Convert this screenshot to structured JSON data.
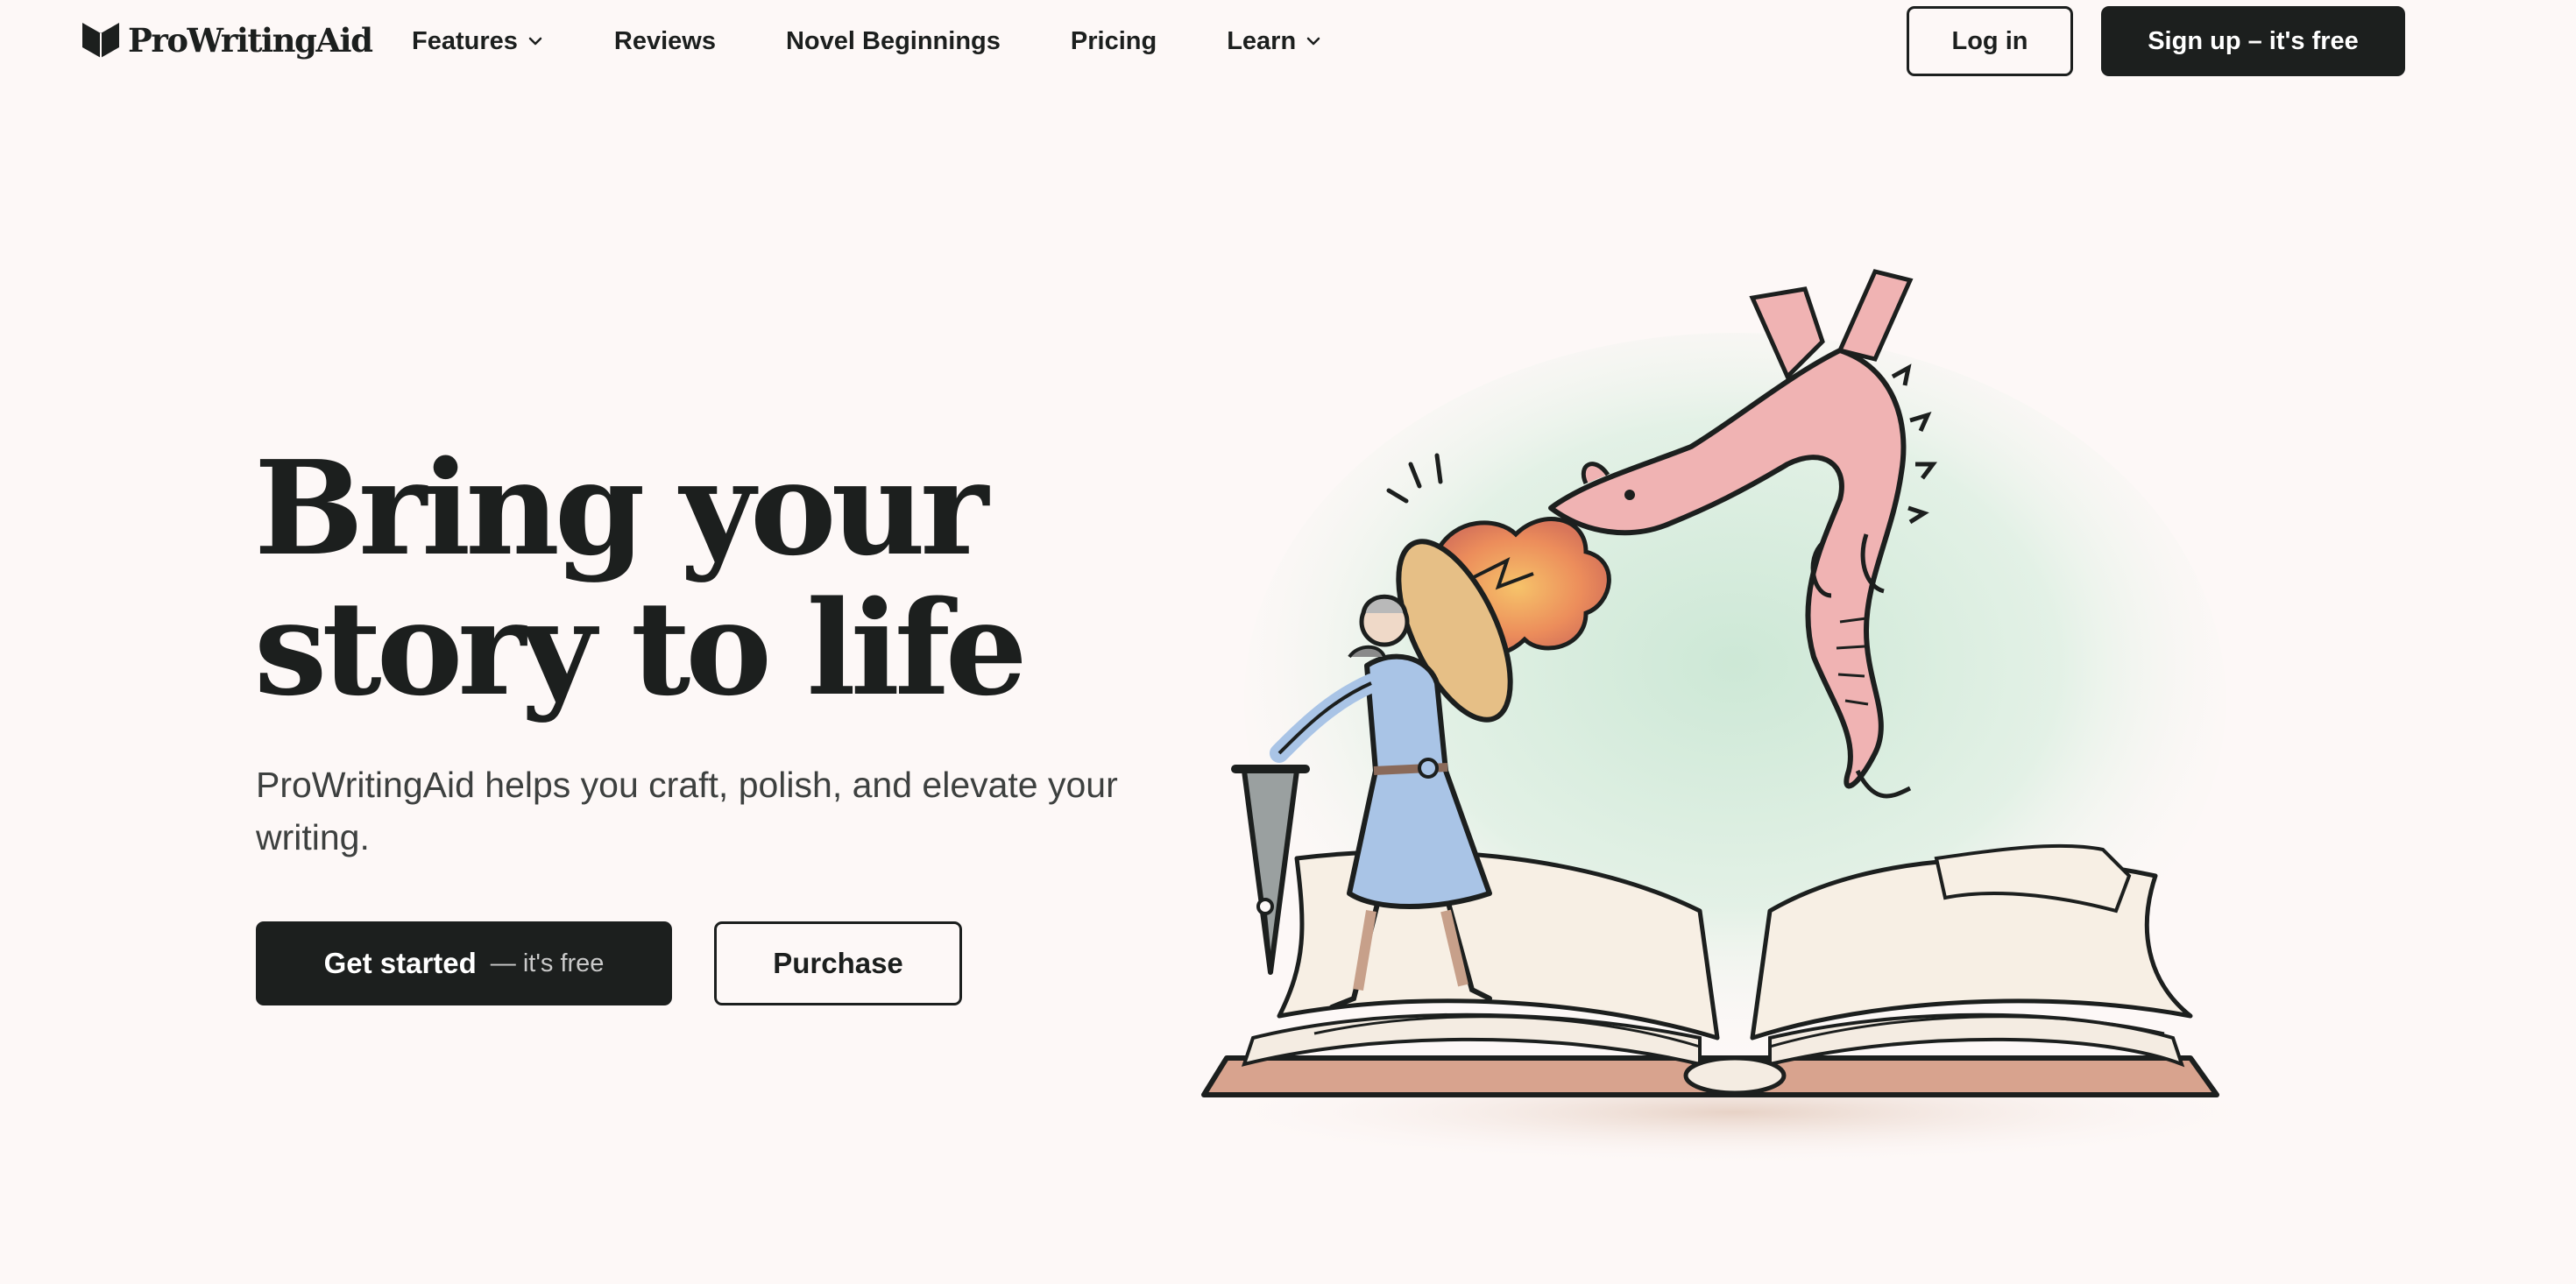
{
  "brand": {
    "name": "ProWritingAid"
  },
  "nav": {
    "items": [
      {
        "label": "Features",
        "has_dropdown": true
      },
      {
        "label": "Reviews",
        "has_dropdown": false
      },
      {
        "label": "Novel Beginnings",
        "has_dropdown": false
      },
      {
        "label": "Pricing",
        "has_dropdown": false
      },
      {
        "label": "Learn",
        "has_dropdown": true
      }
    ],
    "login_label": "Log in",
    "signup_label": "Sign up – it's free"
  },
  "hero": {
    "title_line1": "Bring your",
    "title_line2": "story to life",
    "subtitle": "ProWritingAid helps you craft, polish, and elevate your writing.",
    "cta_primary": "Get started",
    "cta_primary_suffix": "— it's free",
    "cta_secondary": "Purchase"
  },
  "colors": {
    "background": "#fdf8f7",
    "ink": "#1c1f1e",
    "dragon": "#f0b3b3",
    "dress": "#a9c4e6",
    "flame": "#f0a060",
    "wash": "#cfe9d8"
  },
  "illustration": {
    "icon": "knight-vs-dragon-on-open-book-illustration"
  }
}
